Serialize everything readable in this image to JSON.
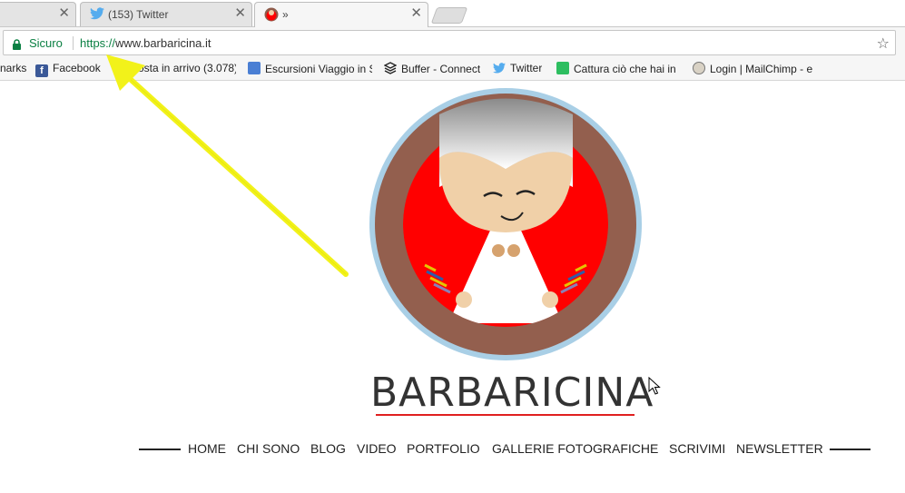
{
  "tabs": [
    {
      "title": "",
      "close": "✕"
    },
    {
      "title": "(153) Twitter",
      "close": "✕"
    },
    {
      "title": "»",
      "close": "✕"
    }
  ],
  "omnibox": {
    "secure_label": "Sicuro",
    "url_scheme": "https://",
    "url_host": "www.barbaricina.it"
  },
  "bookmarks": [
    {
      "label": "narks",
      "icon": "none"
    },
    {
      "label": "Facebook",
      "icon": "facebook-icon"
    },
    {
      "label": "Posta in arrivo (3.078)",
      "icon": "none"
    },
    {
      "label": "Escursioni Viaggio in S",
      "icon": "google-maps-icon"
    },
    {
      "label": "Buffer - Connect",
      "icon": "buffer-icon"
    },
    {
      "label": "Twitter",
      "icon": "twitter-icon"
    },
    {
      "label": "Cattura ciò che hai in",
      "icon": "evernote-icon"
    },
    {
      "label": "Login | MailChimp - e",
      "icon": "mailchimp-icon"
    }
  ],
  "site": {
    "brand": "BARBARICINA",
    "nav": [
      "HOME",
      "CHI SONO",
      "BLOG",
      "VIDEO",
      "PORTFOLIO",
      "GALLERIE FOTOGRAFICHE",
      "SCRIVIMI",
      "NEWSLETTER"
    ]
  },
  "colors": {
    "secure_green": "#0b8043",
    "accent_red": "#e02020",
    "annotation_yellow": "#f2f21a"
  }
}
